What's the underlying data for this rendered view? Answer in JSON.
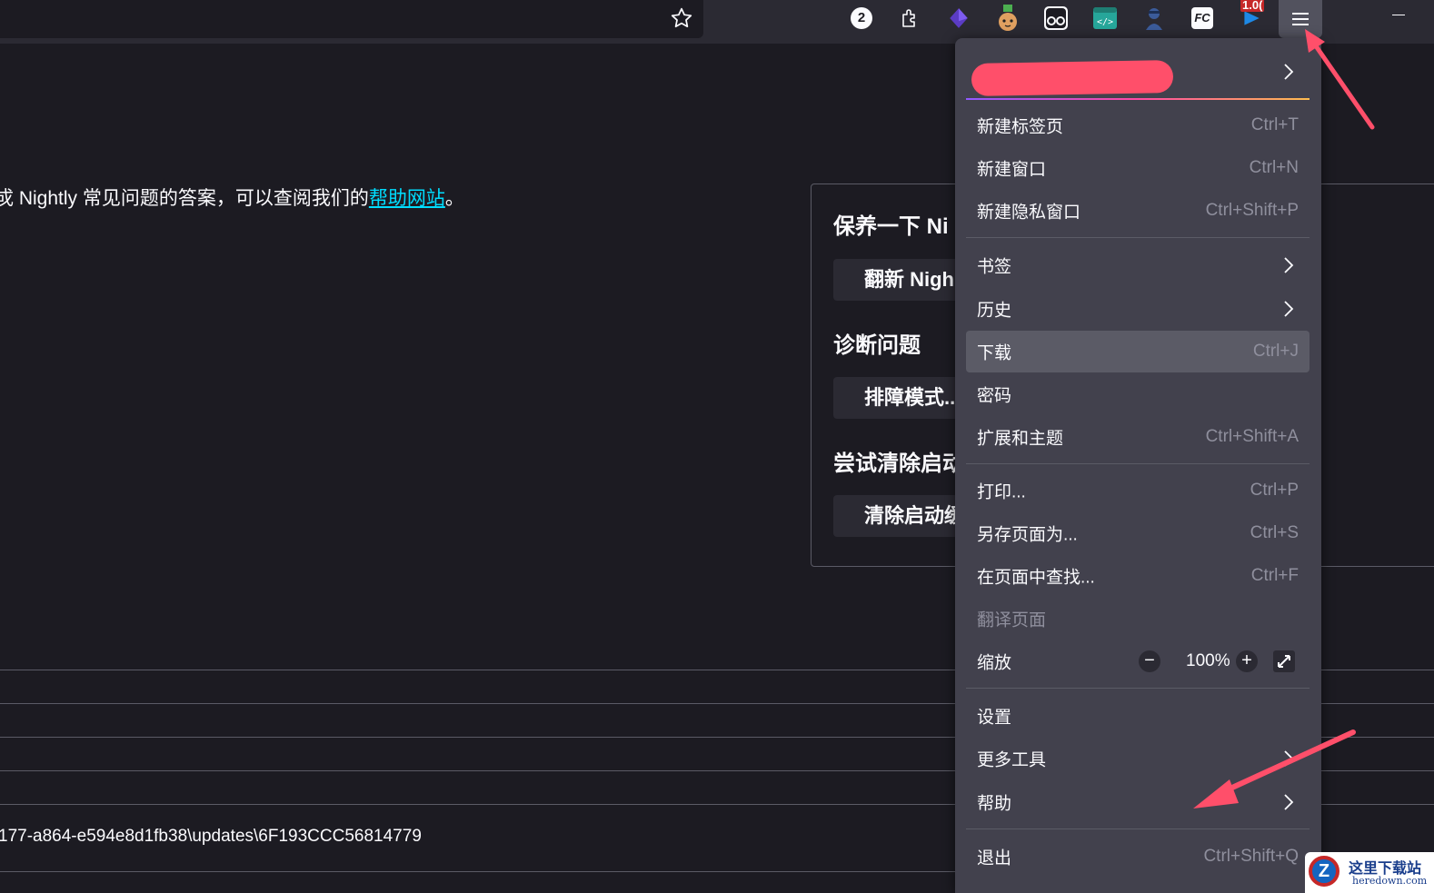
{
  "toolbar": {
    "downloads_badge": "2",
    "ext_badge": "1.0(",
    "icons": [
      "bookmark-star-icon",
      "badge-counter-icon",
      "extensions-puzzle-icon",
      "purple-cube-extension-icon",
      "cat-extension-icon",
      "glasses-extension-icon",
      "code-extension-icon",
      "agent-extension-icon",
      "fc-extension-icon",
      "play-extension-icon",
      "hamburger-menu-icon"
    ],
    "fc_label": "FC"
  },
  "page": {
    "intro_prefix": "戓 Nightly 常见问题的答案，可以查阅我们的",
    "intro_link": "帮助网站",
    "intro_suffix": "。",
    "panel": {
      "heading1": "保养一下 Ni",
      "button1": "翻新 Nigh",
      "heading2": "诊断问题",
      "button2": "排障模式...",
      "heading3": "尝试清除启动",
      "button3": "清除启动缓"
    },
    "path_text": "177-a864-e594e8d1fb38\\updates\\6F193CCC56814779"
  },
  "menu": {
    "account": "",
    "items": [
      {
        "label": "新建标签页",
        "shortcut": "Ctrl+T"
      },
      {
        "label": "新建窗口",
        "shortcut": "Ctrl+N"
      },
      {
        "label": "新建隐私窗口",
        "shortcut": "Ctrl+Shift+P"
      },
      {
        "label": "书签",
        "shortcut": ""
      },
      {
        "label": "历史",
        "shortcut": ""
      },
      {
        "label": "下载",
        "shortcut": "Ctrl+J"
      },
      {
        "label": "密码",
        "shortcut": ""
      },
      {
        "label": "扩展和主题",
        "shortcut": "Ctrl+Shift+A"
      },
      {
        "label": "打印...",
        "shortcut": "Ctrl+P"
      },
      {
        "label": "另存页面为...",
        "shortcut": "Ctrl+S"
      },
      {
        "label": "在页面中查找...",
        "shortcut": "Ctrl+F"
      },
      {
        "label": "翻译页面",
        "shortcut": ""
      },
      {
        "label": "缩放",
        "shortcut": ""
      },
      {
        "label": "设置",
        "shortcut": ""
      },
      {
        "label": "更多工具",
        "shortcut": ""
      },
      {
        "label": "帮助",
        "shortcut": ""
      },
      {
        "label": "退出",
        "shortcut": "Ctrl+Shift+Q"
      }
    ],
    "zoom": {
      "minus": "−",
      "value": "100%",
      "plus": "+"
    }
  },
  "watermark": {
    "line1": "这里下载站",
    "line2": "heredown.com",
    "mark": "Z"
  },
  "colors": {
    "accent": "#00ddff",
    "arrow": "#ff4f6a",
    "menu_bg": "#42414d",
    "page_bg": "#1c1b22"
  }
}
